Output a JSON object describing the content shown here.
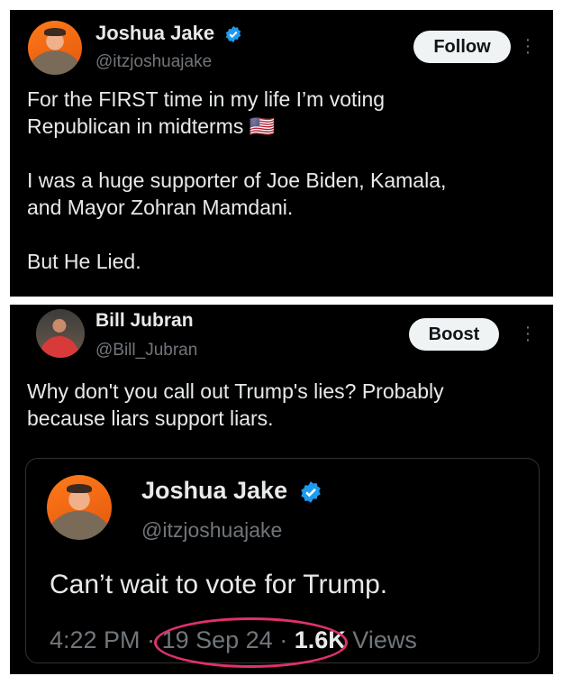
{
  "post1": {
    "name": "Joshua Jake",
    "handle": "@itzjoshuajake",
    "follow_label": "Follow",
    "text": "For the FIRST time in my life I’m voting\nRepublican in midterms 🇺🇸\n\nI was a huge supporter of Joe Biden, Kamala,\nand Mayor Zohran Mamdani.\n\nBut He Lied."
  },
  "post2": {
    "name": "Bill Jubran",
    "handle": "@Bill_Jubran",
    "boost_label": "Boost",
    "text": "Why don't you call out Trump's lies? Probably\nbecause liars support liars.",
    "quote": {
      "name": "Joshua Jake",
      "handle": "@itzjoshuajake",
      "text": "Can’t wait to vote for Trump.",
      "time": "4:22 PM",
      "sep": "·",
      "date": "19 Sep 24",
      "views_count": "1.6K",
      "views_label": "Views"
    }
  },
  "colors": {
    "background": "#000000",
    "text": "#e7e9ea",
    "muted": "#71767b",
    "verified": "#1d9bf0",
    "annotation_circle": "#e0306f"
  }
}
